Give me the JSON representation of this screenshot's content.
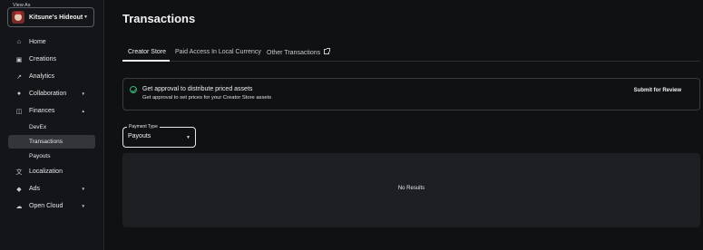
{
  "sidebar": {
    "view_as_label": "View As",
    "view_as_name": "Kitsune's Hideout",
    "items": [
      {
        "label": "Home",
        "icon": "home-icon"
      },
      {
        "label": "Creations",
        "icon": "creations-icon"
      },
      {
        "label": "Analytics",
        "icon": "analytics-icon"
      },
      {
        "label": "Collaboration",
        "icon": "collaboration-icon"
      },
      {
        "label": "Finances",
        "icon": "finances-icon"
      },
      {
        "label": "DevEx"
      },
      {
        "label": "Transactions"
      },
      {
        "label": "Payouts"
      },
      {
        "label": "Localization",
        "icon": "localization-icon"
      },
      {
        "label": "Ads",
        "icon": "ads-icon"
      },
      {
        "label": "Open Cloud",
        "icon": "cloud-icon"
      }
    ]
  },
  "page": {
    "title": "Transactions"
  },
  "tabs": [
    {
      "label": "Creator Store"
    },
    {
      "label": "Paid Access In Local Currency"
    },
    {
      "label": "Other Transactions"
    }
  ],
  "alert": {
    "title": "Get approval to distribute priced assets",
    "description": "Get approval to set prices for your Creator Store assets",
    "action": "Submit for Review",
    "accent_color": "#38b36a"
  },
  "payment_type": {
    "label": "Payment Type",
    "value": "Payouts"
  },
  "results": {
    "empty_text": "No Results"
  }
}
